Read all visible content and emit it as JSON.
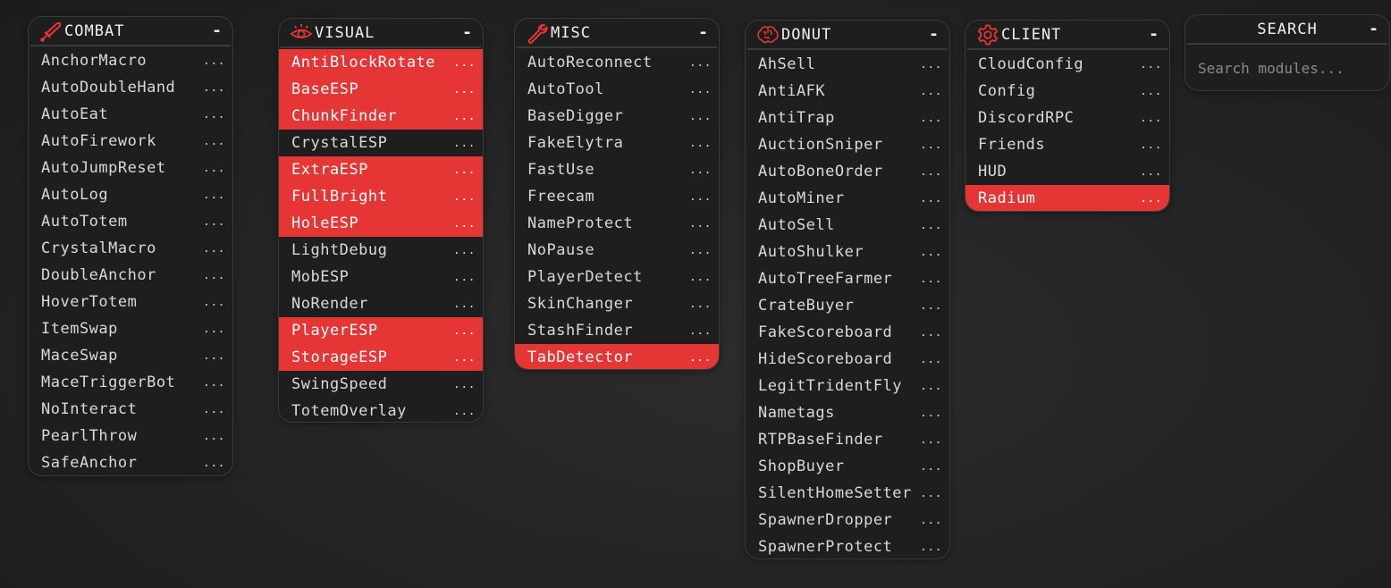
{
  "accent_color": "#e53535",
  "panels": {
    "combat": {
      "title": "COMBAT",
      "icon": "sword-icon",
      "minimize": "-",
      "modules": [
        {
          "name": "AnchorMacro",
          "more": "...",
          "enabled": false
        },
        {
          "name": "AutoDoubleHand",
          "more": "...",
          "enabled": false
        },
        {
          "name": "AutoEat",
          "more": "...",
          "enabled": false
        },
        {
          "name": "AutoFirework",
          "more": "...",
          "enabled": false
        },
        {
          "name": "AutoJumpReset",
          "more": "...",
          "enabled": false
        },
        {
          "name": "AutoLog",
          "more": "...",
          "enabled": false
        },
        {
          "name": "AutoTotem",
          "more": "...",
          "enabled": false
        },
        {
          "name": "CrystalMacro",
          "more": "...",
          "enabled": false
        },
        {
          "name": "DoubleAnchor",
          "more": "...",
          "enabled": false
        },
        {
          "name": "HoverTotem",
          "more": "...",
          "enabled": false
        },
        {
          "name": "ItemSwap",
          "more": "...",
          "enabled": false
        },
        {
          "name": "MaceSwap",
          "more": "...",
          "enabled": false
        },
        {
          "name": "MaceTriggerBot",
          "more": "...",
          "enabled": false
        },
        {
          "name": "NoInteract",
          "more": "...",
          "enabled": false
        },
        {
          "name": "PearlThrow",
          "more": "...",
          "enabled": false
        },
        {
          "name": "SafeAnchor",
          "more": "...",
          "enabled": false
        }
      ]
    },
    "visual": {
      "title": "VISUAL",
      "icon": "eye-icon",
      "minimize": "-",
      "modules": [
        {
          "name": "AntiBlockRotate",
          "more": "...",
          "enabled": true
        },
        {
          "name": "BaseESP",
          "more": "...",
          "enabled": true
        },
        {
          "name": "ChunkFinder",
          "more": "...",
          "enabled": true
        },
        {
          "name": "CrystalESP",
          "more": "...",
          "enabled": false
        },
        {
          "name": "ExtraESP",
          "more": "...",
          "enabled": true
        },
        {
          "name": "FullBright",
          "more": "...",
          "enabled": true
        },
        {
          "name": "HoleESP",
          "more": "...",
          "enabled": true
        },
        {
          "name": "LightDebug",
          "more": "...",
          "enabled": false
        },
        {
          "name": "MobESP",
          "more": "...",
          "enabled": false
        },
        {
          "name": "NoRender",
          "more": "...",
          "enabled": false
        },
        {
          "name": "PlayerESP",
          "more": "...",
          "enabled": true
        },
        {
          "name": "StorageESP",
          "more": "...",
          "enabled": true
        },
        {
          "name": "SwingSpeed",
          "more": "...",
          "enabled": false
        },
        {
          "name": "TotemOverlay",
          "more": "...",
          "enabled": false
        }
      ]
    },
    "misc": {
      "title": "MISC",
      "icon": "wrench-icon",
      "minimize": "-",
      "modules": [
        {
          "name": "AutoReconnect",
          "more": "...",
          "enabled": false
        },
        {
          "name": "AutoTool",
          "more": "...",
          "enabled": false
        },
        {
          "name": "BaseDigger",
          "more": "...",
          "enabled": false
        },
        {
          "name": "FakeElytra",
          "more": "...",
          "enabled": false
        },
        {
          "name": "FastUse",
          "more": "...",
          "enabled": false
        },
        {
          "name": "Freecam",
          "more": "...",
          "enabled": false
        },
        {
          "name": "NameProtect",
          "more": "...",
          "enabled": false
        },
        {
          "name": "NoPause",
          "more": "...",
          "enabled": false
        },
        {
          "name": "PlayerDetect",
          "more": "...",
          "enabled": false
        },
        {
          "name": "SkinChanger",
          "more": "...",
          "enabled": false
        },
        {
          "name": "StashFinder",
          "more": "...",
          "enabled": false
        },
        {
          "name": "TabDetector",
          "more": "...",
          "enabled": true
        }
      ]
    },
    "donut": {
      "title": "DONUT",
      "icon": "brain-icon",
      "minimize": "-",
      "modules": [
        {
          "name": "AhSell",
          "more": "...",
          "enabled": false
        },
        {
          "name": "AntiAFK",
          "more": "...",
          "enabled": false
        },
        {
          "name": "AntiTrap",
          "more": "...",
          "enabled": false
        },
        {
          "name": "AuctionSniper",
          "more": "...",
          "enabled": false
        },
        {
          "name": "AutoBoneOrder",
          "more": "...",
          "enabled": false
        },
        {
          "name": "AutoMiner",
          "more": "...",
          "enabled": false
        },
        {
          "name": "AutoSell",
          "more": "...",
          "enabled": false
        },
        {
          "name": "AutoShulker",
          "more": "...",
          "enabled": false
        },
        {
          "name": "AutoTreeFarmer",
          "more": "...",
          "enabled": false
        },
        {
          "name": "CrateBuyer",
          "more": "...",
          "enabled": false
        },
        {
          "name": "FakeScoreboard",
          "more": "...",
          "enabled": false
        },
        {
          "name": "HideScoreboard",
          "more": "...",
          "enabled": false
        },
        {
          "name": "LegitTridentFly",
          "more": "...",
          "enabled": false
        },
        {
          "name": "Nametags",
          "more": "...",
          "enabled": false
        },
        {
          "name": "RTPBaseFinder",
          "more": "...",
          "enabled": false
        },
        {
          "name": "ShopBuyer",
          "more": "...",
          "enabled": false
        },
        {
          "name": "SilentHomeSetter",
          "more": "...",
          "enabled": false
        },
        {
          "name": "SpawnerDropper",
          "more": "...",
          "enabled": false
        },
        {
          "name": "SpawnerProtect",
          "more": "...",
          "enabled": false
        }
      ]
    },
    "client": {
      "title": "CLIENT",
      "icon": "gear-icon",
      "minimize": "-",
      "modules": [
        {
          "name": "CloudConfig",
          "more": "...",
          "enabled": false
        },
        {
          "name": "Config",
          "more": "...",
          "enabled": false
        },
        {
          "name": "DiscordRPC",
          "more": "...",
          "enabled": false
        },
        {
          "name": "Friends",
          "more": "...",
          "enabled": false
        },
        {
          "name": "HUD",
          "more": "...",
          "enabled": false
        },
        {
          "name": "Radium",
          "more": "...",
          "enabled": true
        }
      ]
    },
    "search": {
      "title": "SEARCH",
      "minimize": "-",
      "placeholder": "Search modules...",
      "value": ""
    }
  }
}
